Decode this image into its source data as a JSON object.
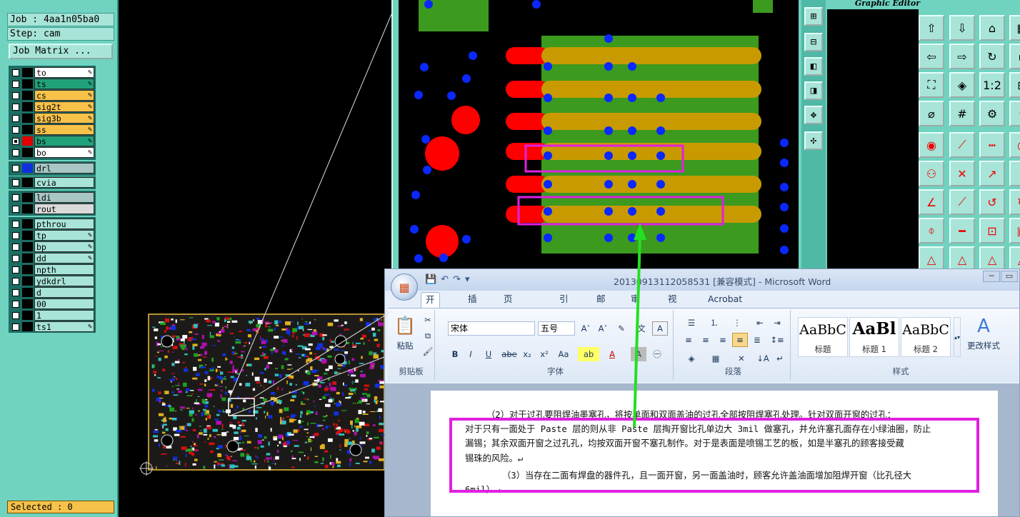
{
  "left_panel": {
    "job_label": "Job : 4aa1n05ba0",
    "step_label": "Step: cam",
    "job_matrix_button": "Job Matrix ...",
    "layers": [
      {
        "name": "to",
        "color": "#ffffff",
        "swatch": "#000000",
        "editable": true,
        "checked": false
      },
      {
        "name": "ts",
        "color": "#22a27a",
        "swatch": "#000000",
        "editable": true,
        "checked": false
      },
      {
        "name": "cs",
        "color": "#f7c24a",
        "swatch": "#000000",
        "editable": true,
        "checked": false
      },
      {
        "name": "sig2t",
        "color": "#f7c24a",
        "swatch": "#000000",
        "editable": true,
        "checked": false
      },
      {
        "name": "sig3b",
        "color": "#f7c24a",
        "swatch": "#000000",
        "editable": true,
        "checked": false
      },
      {
        "name": "ss",
        "color": "#f7c24a",
        "swatch": "#000000",
        "editable": true,
        "checked": false
      },
      {
        "name": "bs",
        "color": "#22a27a",
        "swatch": "#e00000",
        "editable": true,
        "checked": true
      },
      {
        "name": "bo",
        "color": "#ffffff",
        "swatch": "#000000",
        "editable": true,
        "checked": false
      },
      {
        "name": "drl",
        "color": "#a8c6c6",
        "swatch": "#1030e0",
        "editable": false,
        "checked": false
      },
      {
        "name": "cvia",
        "color": "#a8e4d8",
        "swatch": "#000000",
        "editable": false,
        "checked": false
      },
      {
        "name": "ldi",
        "color": "#a8c6c6",
        "swatch": "#000000",
        "editable": false,
        "checked": false
      },
      {
        "name": "rout",
        "color": "#dadada",
        "swatch": "#000000",
        "editable": false,
        "checked": false
      },
      {
        "name": "pthrou",
        "color": "#a8e4d8",
        "swatch": "#000000",
        "editable": false,
        "checked": false
      },
      {
        "name": "tp",
        "color": "#a8e4d8",
        "swatch": "#000000",
        "editable": true,
        "checked": false
      },
      {
        "name": "bp",
        "color": "#a8e4d8",
        "swatch": "#000000",
        "editable": true,
        "checked": false
      },
      {
        "name": "dd",
        "color": "#a8e4d8",
        "swatch": "#000000",
        "editable": true,
        "checked": false
      },
      {
        "name": "npth",
        "color": "#a8e4d8",
        "swatch": "#000000",
        "editable": false,
        "checked": false
      },
      {
        "name": "ydkdrl",
        "color": "#a8e4d8",
        "swatch": "#000000",
        "editable": false,
        "checked": false
      },
      {
        "name": "d",
        "color": "#a8e4d8",
        "swatch": "#000000",
        "editable": false,
        "checked": false
      },
      {
        "name": "00",
        "color": "#a8e4d8",
        "swatch": "#000000",
        "editable": false,
        "checked": false
      },
      {
        "name": "1",
        "color": "#a8e4d8",
        "swatch": "#000000",
        "editable": false,
        "checked": false
      },
      {
        "name": "ts1",
        "color": "#a8e4d8",
        "swatch": "#000000",
        "editable": true,
        "checked": false
      }
    ],
    "selected_label": "Selected : 0"
  },
  "graphic_editor": {
    "title": "Graphic Editor"
  },
  "word": {
    "title": "20130913112058531 [兼容模式] - Microsoft Word",
    "tabs": [
      "开始",
      "插入",
      "页面布局",
      "引用",
      "邮件",
      "审阅",
      "视图",
      "Acrobat"
    ],
    "active_tab": "开始",
    "clipboard": {
      "paste_label": "粘贴",
      "group_label": "剪贴板"
    },
    "font": {
      "family": "宋体",
      "size": "五号",
      "group_label": "字体"
    },
    "paragraph": {
      "group_label": "段落"
    },
    "styles": {
      "group_label": "样式",
      "tiles": [
        {
          "sample": "AaBbC",
          "name": "标题"
        },
        {
          "sample": "AaBl",
          "name": "标题 1"
        },
        {
          "sample": "AaBbC",
          "name": "标题 2"
        }
      ],
      "change_styles_label": "更改样式"
    },
    "document_lines": [
      "（2）对于过孔要阻焊油墨塞孔，将按单面和双面盖油的过孔全部按阻焊塞孔处理。针对双面开窗的过孔：",
      "对于只有一面处于 Paste 层的则从非 Paste 层掏开窗比孔单边大 3mil 做塞孔，并允许塞孔面存在小绿油圈，防止",
      "漏锡；其余双面开窗之过孔孔，均按双面开窗不塞孔制作。对于是表面是喷锡工艺的板，如是半塞孔的顾客接受藏",
      "锡珠的风险。↵",
      "（3）当存在二面有焊盘的器件孔，且一面开窗，另一面盖油时，顾客允许盖油面增加阻焊开窗（比孔径大",
      "6mil）↵"
    ]
  },
  "colors": {
    "panel_teal": "#6fd3c0",
    "highlight_magenta": "#e020e0",
    "arrow_green": "#22e022",
    "pad_red": "#ff0000",
    "via_blue": "#0a28ff",
    "copper_gold": "#c89a00",
    "mask_green": "#3c9a1e"
  }
}
